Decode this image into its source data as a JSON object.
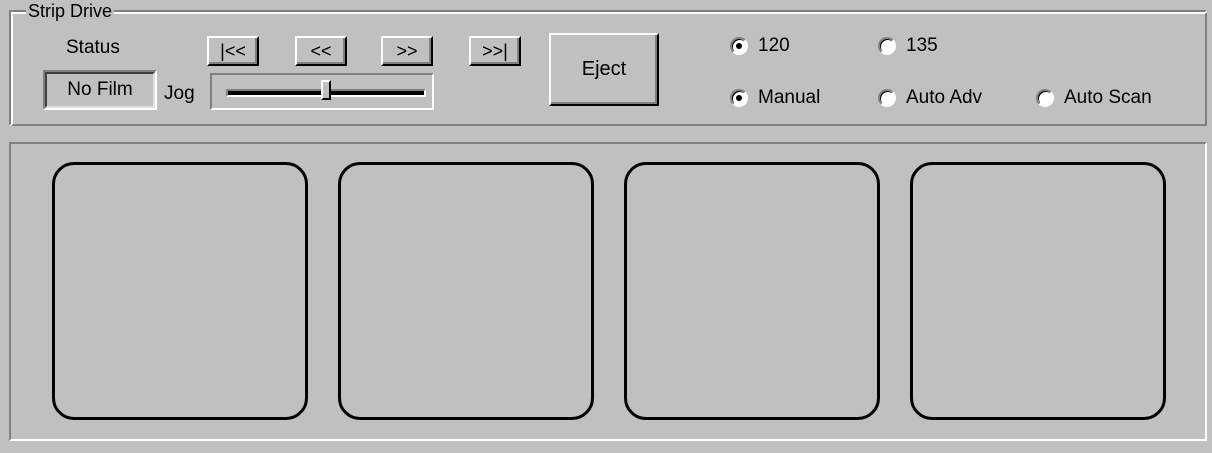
{
  "group": {
    "title": "Strip Drive"
  },
  "status": {
    "label": "Status",
    "value": "No Film"
  },
  "jog": {
    "label": "Jog",
    "position": 0.5
  },
  "nav": {
    "first_label": "|<<",
    "prev_label": "<<",
    "next_label": ">>",
    "last_label": ">>|"
  },
  "eject": {
    "label": "Eject"
  },
  "film_format": {
    "options": [
      {
        "label": "120",
        "selected": true
      },
      {
        "label": "135",
        "selected": false
      }
    ]
  },
  "advance_mode": {
    "options": [
      {
        "label": "Manual",
        "selected": true
      },
      {
        "label": "Auto Adv",
        "selected": false
      },
      {
        "label": "Auto Scan",
        "selected": false
      }
    ]
  },
  "frames": {
    "count": 4
  }
}
